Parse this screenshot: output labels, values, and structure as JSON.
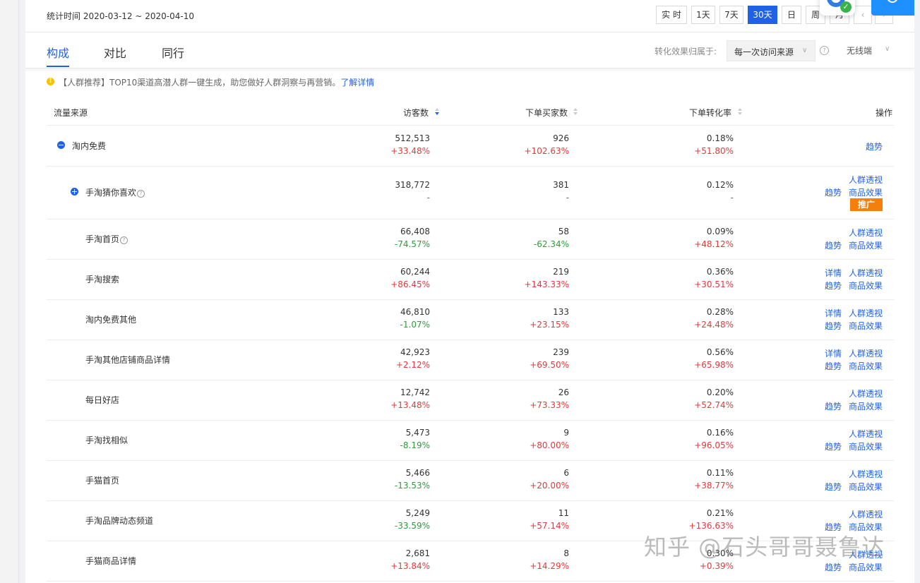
{
  "header": {
    "stat_time_label": "统计时间 2020-03-12 ~ 2020-04-10",
    "time_buttons": [
      "实 时",
      "1天",
      "7天",
      "30天",
      "日",
      "周",
      "月"
    ],
    "active_time": "30天"
  },
  "tabs": [
    "构成",
    "对比",
    "同行"
  ],
  "active_tab": "构成",
  "attribution": {
    "label": "转化效果归属于:",
    "value": "每一次访问来源",
    "device": "无线端"
  },
  "notice": {
    "text": "【人群推荐】TOP10渠道高潜人群一键生成，助您做好人群洞察与再营销。",
    "link": "了解详情"
  },
  "table": {
    "columns": [
      "流量来源",
      "访客数",
      "下单买家数",
      "下单转化率",
      "操作"
    ],
    "rows": [
      {
        "source": "淘内免费",
        "visitors": "512,513",
        "visitors_change": "+33.48%",
        "buyers": "926",
        "buyers_change": "+102.63%",
        "rate": "0.18%",
        "rate_change": "+51.80%",
        "ops": [
          "趋势"
        ]
      },
      {
        "source": "手淘猜你喜欢",
        "visitors": "318,772",
        "visitors_change": "-",
        "buyers": "381",
        "buyers_change": "-",
        "rate": "0.12%",
        "rate_change": "-",
        "ops": [
          "人群透视",
          "趋势",
          "商品效果"
        ],
        "promo": "推广"
      },
      {
        "source": "手淘首页",
        "visitors": "66,408",
        "visitors_change": "-74.57%",
        "buyers": "58",
        "buyers_change": "-62.34%",
        "rate": "0.09%",
        "rate_change": "+48.12%",
        "ops": [
          "人群透视",
          "趋势",
          "商品效果"
        ]
      },
      {
        "source": "手淘搜索",
        "visitors": "60,244",
        "visitors_change": "+86.45%",
        "buyers": "219",
        "buyers_change": "+143.33%",
        "rate": "0.36%",
        "rate_change": "+30.51%",
        "ops": [
          "详情",
          "人群透视",
          "趋势",
          "商品效果"
        ]
      },
      {
        "source": "淘内免费其他",
        "visitors": "46,810",
        "visitors_change": "-1.07%",
        "buyers": "133",
        "buyers_change": "+23.15%",
        "rate": "0.28%",
        "rate_change": "+24.48%",
        "ops": [
          "详情",
          "人群透视",
          "趋势",
          "商品效果"
        ]
      },
      {
        "source": "手淘其他店铺商品详情",
        "visitors": "42,923",
        "visitors_change": "+2.12%",
        "buyers": "239",
        "buyers_change": "+69.50%",
        "rate": "0.56%",
        "rate_change": "+65.98%",
        "ops": [
          "详情",
          "人群透视",
          "趋势",
          "商品效果"
        ]
      },
      {
        "source": "每日好店",
        "visitors": "12,742",
        "visitors_change": "+13.48%",
        "buyers": "26",
        "buyers_change": "+73.33%",
        "rate": "0.20%",
        "rate_change": "+52.74%",
        "ops": [
          "人群透视",
          "趋势",
          "商品效果"
        ]
      },
      {
        "source": "手淘找相似",
        "visitors": "5,473",
        "visitors_change": "-8.19%",
        "buyers": "9",
        "buyers_change": "+80.00%",
        "rate": "0.16%",
        "rate_change": "+96.05%",
        "ops": [
          "人群透视",
          "趋势",
          "商品效果"
        ]
      },
      {
        "source": "手猫首页",
        "visitors": "5,466",
        "visitors_change": "-13.53%",
        "buyers": "6",
        "buyers_change": "+20.00%",
        "rate": "0.11%",
        "rate_change": "+38.77%",
        "ops": [
          "人群透视",
          "趋势",
          "商品效果"
        ]
      },
      {
        "source": "手淘品牌动态频道",
        "visitors": "5,249",
        "visitors_change": "-33.59%",
        "buyers": "11",
        "buyers_change": "+57.14%",
        "rate": "0.21%",
        "rate_change": "+136.63%",
        "ops": [
          "人群透视",
          "趋势",
          "商品效果"
        ]
      },
      {
        "source": "手猫商品详情",
        "visitors": "2,681",
        "visitors_change": "+13.84%",
        "buyers": "8",
        "buyers_change": "+14.29%",
        "rate": "0.30%",
        "rate_change": "+0.39%",
        "ops": [
          "人群透视",
          "趋势",
          "商品效果"
        ]
      }
    ]
  },
  "watermark": "知乎 @石头哥哥聂鲁达",
  "colors": {
    "accent": "#2062e6",
    "up": "#e4393c",
    "down": "#2e9b3d",
    "promo": "#f47f0a"
  }
}
